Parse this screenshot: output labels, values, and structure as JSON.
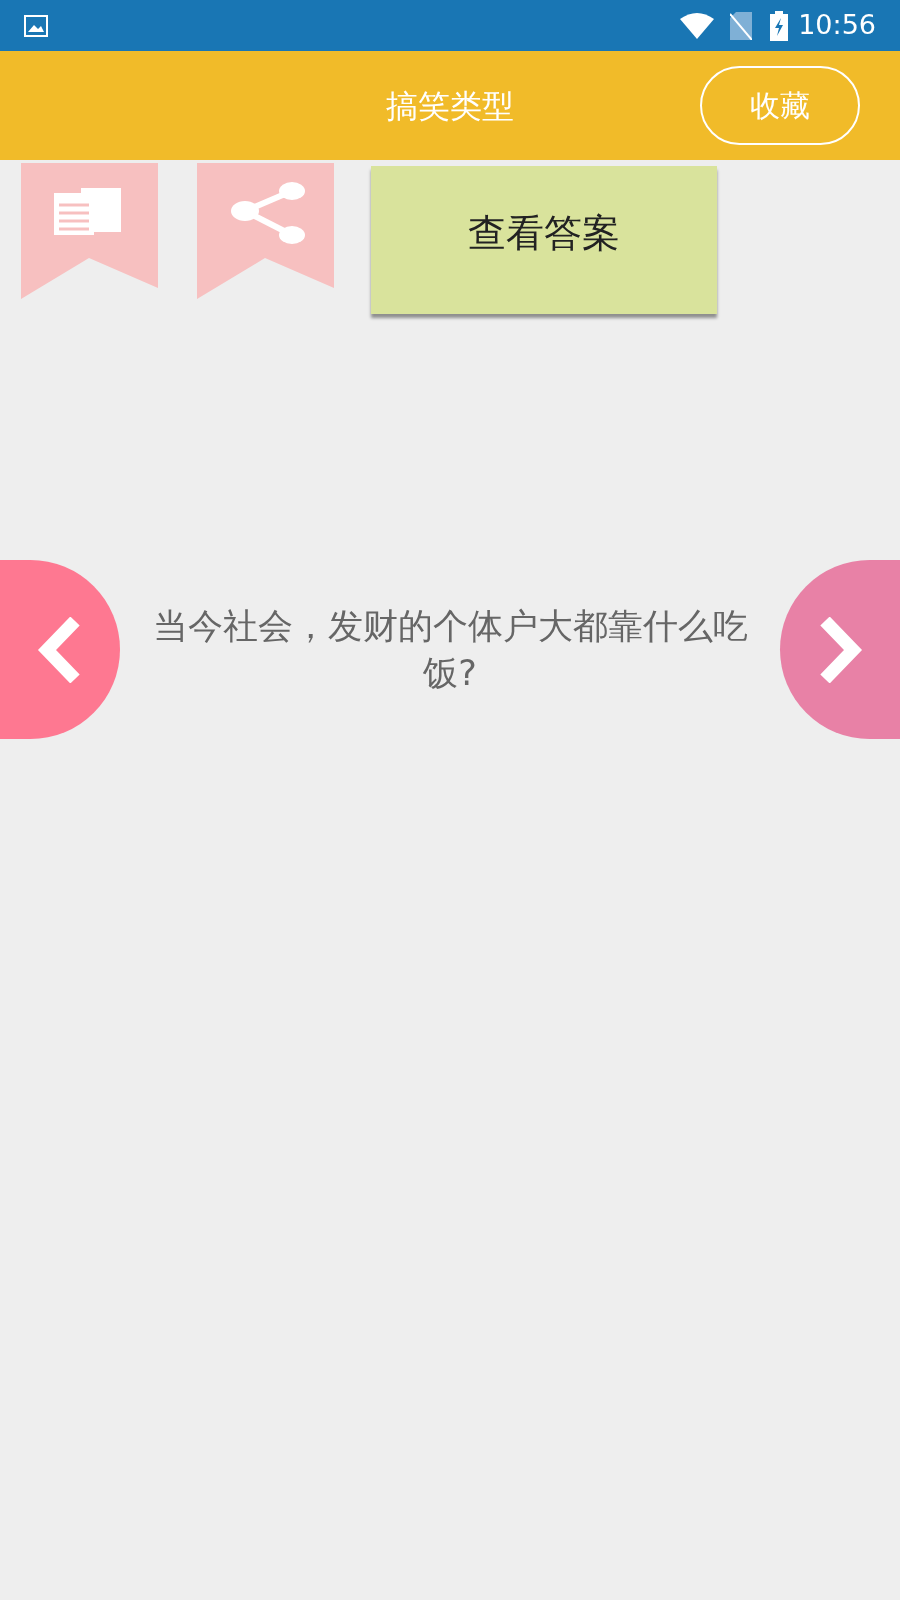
{
  "status_bar": {
    "time": "10:56"
  },
  "header": {
    "title": "搞笑类型",
    "favorite_button": "收藏"
  },
  "answer_button": "查看答案",
  "question": "当今社会，发财的个体户大都靠什么吃饭?"
}
